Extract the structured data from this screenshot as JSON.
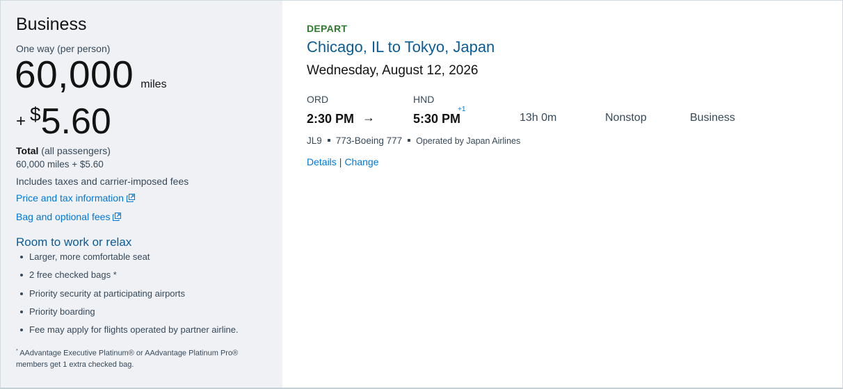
{
  "left": {
    "cabin": "Business",
    "trip_type": "One way (per person)",
    "miles": "60,000",
    "miles_unit": "miles",
    "plus": "+",
    "currency_symbol": "$",
    "fee": "5.60",
    "total_label": "Total",
    "total_suffix": "(all passengers)",
    "total_value": "60,000 miles + $5.60",
    "includes": "Includes taxes and carrier-imposed fees",
    "price_link": "Price and tax information",
    "bag_link": "Bag and optional fees",
    "perks_title": "Room to work or relax",
    "perks": [
      "Larger, more comfortable seat",
      "2 free checked bags *",
      "Priority security at participating airports",
      "Priority boarding",
      "Fee may apply for flights operated by partner airline."
    ],
    "footnote_star": "*",
    "footnote_text": "AAdvantage Executive Platinum® or AAdvantage Platinum Pro® members get 1 extra checked bag."
  },
  "flight": {
    "direction": "DEPART",
    "route": "Chicago, IL to Tokyo, Japan",
    "date": "Wednesday, August 12, 2026",
    "origin_code": "ORD",
    "dest_code": "HND",
    "depart_time": "2:30 PM",
    "arrow": "→",
    "arrive_time": "5:30 PM",
    "day_offset": "+1",
    "duration": "13h 0m",
    "stops": "Nonstop",
    "cabin": "Business",
    "flight_number": "JL9",
    "aircraft": "773-Boeing 777",
    "operated_by": "Operated by Japan Airlines",
    "details_label": "Details",
    "separator": "|",
    "change_label": "Change"
  },
  "colors": {
    "link": "#0078d2",
    "heading_blue": "#0b5c94",
    "depart_green": "#2d7a2d",
    "panel_bg": "#eff1f5"
  }
}
